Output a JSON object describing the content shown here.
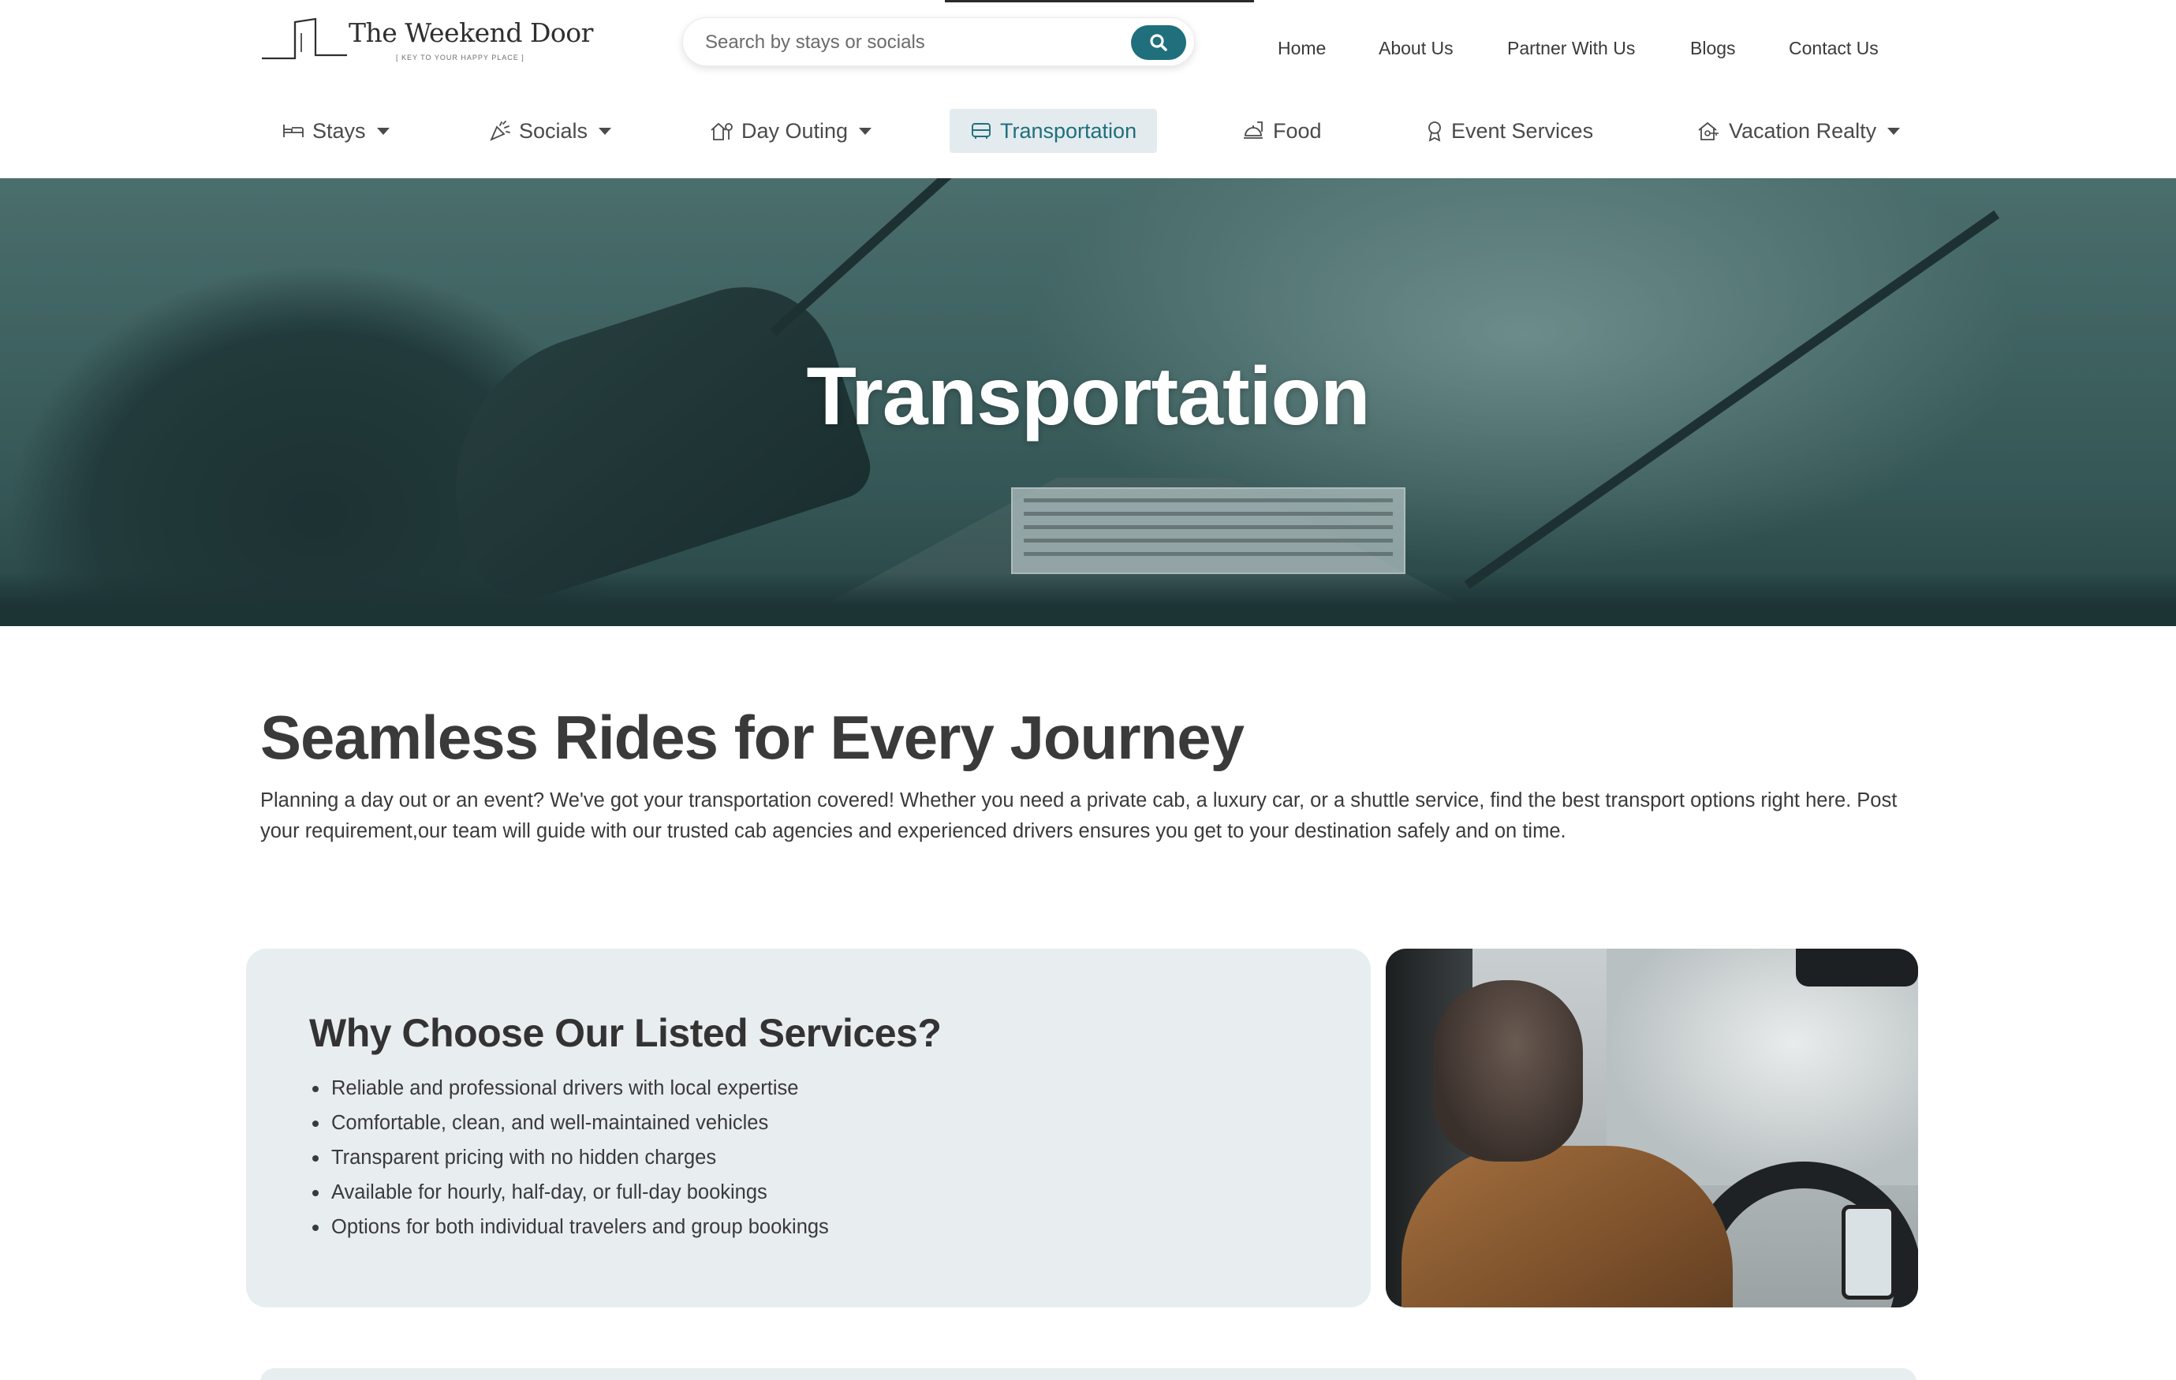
{
  "brand": {
    "name": "The Weekend Door",
    "tagline": "[ KEY TO YOUR HAPPY PLACE ]",
    "accent_color": "#1f6f7d"
  },
  "search": {
    "placeholder": "Search by stays or socials",
    "button_icon": "search-icon"
  },
  "top_nav": {
    "items": [
      "Home",
      "About Us",
      "Partner With Us",
      "Blogs",
      "Contact Us"
    ]
  },
  "category_nav": {
    "items": [
      {
        "label": "Stays",
        "icon": "bed-icon",
        "dropdown": true,
        "active": false
      },
      {
        "label": "Socials",
        "icon": "party-icon",
        "dropdown": true,
        "active": false
      },
      {
        "label": "Day Outing",
        "icon": "house-tree-icon",
        "dropdown": true,
        "active": false
      },
      {
        "label": "Transportation",
        "icon": "bus-icon",
        "dropdown": false,
        "active": true
      },
      {
        "label": "Food",
        "icon": "food-tray-icon",
        "dropdown": false,
        "active": false
      },
      {
        "label": "Event Services",
        "icon": "award-icon",
        "dropdown": false,
        "active": false
      },
      {
        "label": "Vacation Realty",
        "icon": "home-key-icon",
        "dropdown": true,
        "active": false
      }
    ]
  },
  "hero": {
    "title": "Transportation"
  },
  "intro": {
    "title": "Seamless Rides for Every Journey",
    "text": "Planning a day out or an event? We've got your transportation covered! Whether you need a private cab, a luxury car, or a shuttle service, find the best transport options right here. Post your requirement,our team will guide with our trusted cab agencies and experienced drivers ensures you get to your destination safely and on time."
  },
  "why": {
    "title": "Why Choose Our Listed Services?",
    "items": [
      "Reliable and professional drivers with local expertise",
      "Comfortable, clean, and well-maintained vehicles",
      "Transparent pricing with no hidden charges",
      "Available for hourly, half-day, or full-day bookings",
      "Options for both individual travelers and group bookings"
    ]
  }
}
